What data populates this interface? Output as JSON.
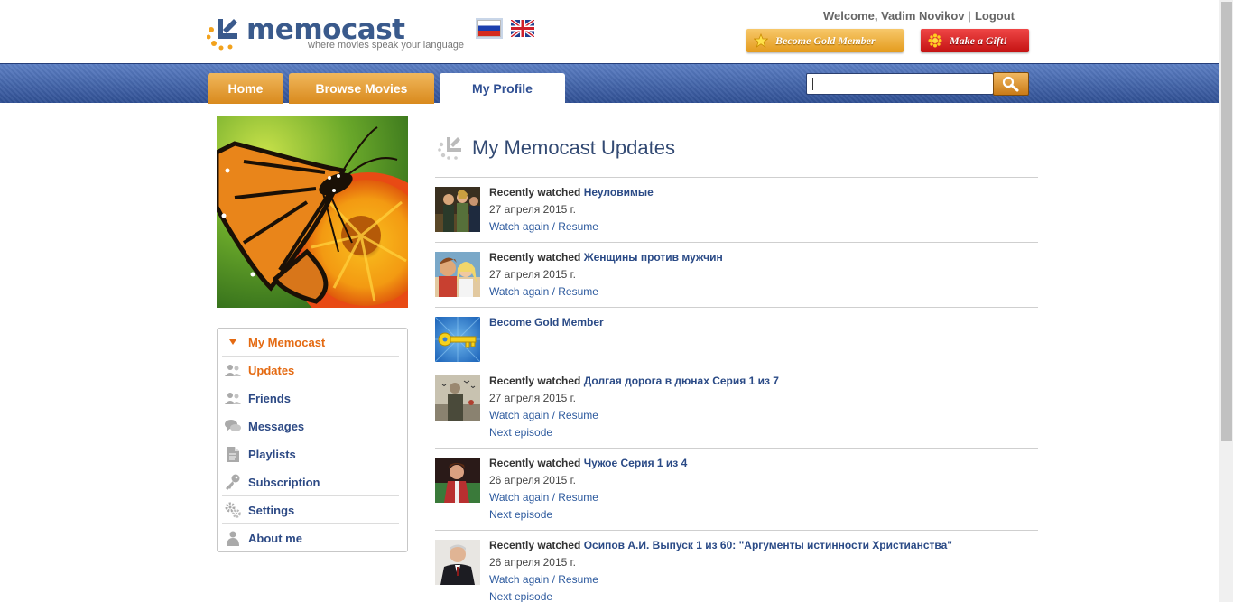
{
  "header": {
    "logo_text": "memocast",
    "logo_tagline": "where movies speak your language",
    "welcome": "Welcome, Vadim Novikov",
    "logout": "Logout",
    "gold_button": "Become Gold Member",
    "gift_button": "Make a Gift!",
    "languages": [
      "ru-flag-icon",
      "uk-flag-icon"
    ]
  },
  "nav": {
    "tabs": [
      "Home",
      "Browse Movies",
      "My Profile"
    ],
    "active_tab": "My Profile",
    "search_value": ""
  },
  "sidebar": {
    "menu": [
      {
        "label": "My Memocast",
        "icon": "triangle-down-icon"
      },
      {
        "label": "Updates",
        "icon": "users-icon"
      },
      {
        "label": "Friends",
        "icon": "users-icon"
      },
      {
        "label": "Messages",
        "icon": "chat-bubbles-icon"
      },
      {
        "label": "Playlists",
        "icon": "document-icon"
      },
      {
        "label": "Subscription",
        "icon": "key-icon"
      },
      {
        "label": "Settings",
        "icon": "gears-icon"
      },
      {
        "label": "About me",
        "icon": "person-icon"
      }
    ]
  },
  "main": {
    "title": "My Memocast Updates",
    "updates": [
      {
        "label": "Recently watched",
        "movie": "Неуловимые",
        "date": "27 апреля 2015 г.",
        "link1": "Watch again / Resume",
        "link2": ""
      },
      {
        "label": "Recently watched",
        "movie": "Женщины против мужчин",
        "date": "27 апреля 2015 г.",
        "link1": "Watch again / Resume",
        "link2": ""
      },
      {
        "label": "",
        "movie": "Become Gold Member",
        "date": "",
        "link1": "",
        "link2": ""
      },
      {
        "label": "Recently watched",
        "movie": "Долгая дорога в дюнах Серия 1 из 7",
        "date": "27 апреля 2015 г.",
        "link1": "Watch again / Resume",
        "link2": "Next episode"
      },
      {
        "label": "Recently watched",
        "movie": "Чужое Серия 1 из 4",
        "date": "26 апреля 2015 г.",
        "link1": "Watch again / Resume",
        "link2": "Next episode"
      },
      {
        "label": "Recently watched",
        "movie": "Осипов А.И. Выпуск 1 из 60: \"Аргументы истинности Христианства\"",
        "date": "26 апреля 2015 г.",
        "link1": "Watch again / Resume",
        "link2": "Next episode"
      }
    ]
  },
  "colors": {
    "nav_blue": "#3a5a9e",
    "tab_orange": "#e49b1c",
    "link_blue": "#2a4a86",
    "active_orange": "#e46a12"
  }
}
